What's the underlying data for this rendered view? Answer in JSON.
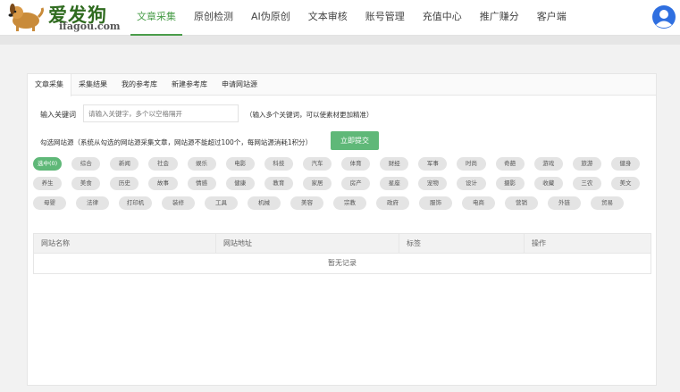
{
  "logo": {
    "cn": "爱发狗",
    "en": "ifagou.com"
  },
  "nav": [
    {
      "label": "文章采集",
      "active": true
    },
    {
      "label": "原创检测",
      "active": false
    },
    {
      "label": "AI伪原创",
      "active": false
    },
    {
      "label": "文本审核",
      "active": false
    },
    {
      "label": "账号管理",
      "active": false
    },
    {
      "label": "充值中心",
      "active": false
    },
    {
      "label": "推广赚分",
      "active": false
    },
    {
      "label": "客户端",
      "active": false
    }
  ],
  "tabs": [
    {
      "label": "文章采集",
      "active": true
    },
    {
      "label": "采集结果",
      "active": false
    },
    {
      "label": "我的参考库",
      "active": false
    },
    {
      "label": "新建参考库",
      "active": false
    },
    {
      "label": "申请网站源",
      "active": false
    }
  ],
  "keyword": {
    "label": "输入关键词",
    "placeholder": "请输入关键字，多个以空格隔开",
    "hint": "（输入多个关键词，可以使素材更加精准）"
  },
  "site_note": "勾选网站源（系统从勾选的网站源采集文章，网站源不能超过100个，每网站源消耗1积分）",
  "submit_label": "立即提交",
  "categories": [
    [
      "选中(0)",
      "综合",
      "新闻",
      "社会",
      "娱乐",
      "电影",
      "科技",
      "汽车",
      "体育",
      "财经",
      "军事",
      "时尚",
      "奇葩",
      "游戏",
      "旅游",
      "健身"
    ],
    [
      "养生",
      "美食",
      "历史",
      "故事",
      "情感",
      "健康",
      "教育",
      "家居",
      "房产",
      "星座",
      "宠物",
      "设计",
      "摄影",
      "收藏",
      "三农",
      "美文"
    ],
    [
      "母婴",
      "法律",
      "打印机",
      "装修",
      "工具",
      "机械",
      "美容",
      "宗教",
      "政府",
      "服饰",
      "电商",
      "营销",
      "外链",
      "贸易"
    ]
  ],
  "selected_category": "选中(0)",
  "table": {
    "headers": [
      "网站名称",
      "网站地址",
      "标签",
      "操作"
    ],
    "empty_text": "暂无记录"
  },
  "colors": {
    "accent": "#5fb878",
    "nav_active": "#4a9d4a",
    "user_icon": "#2f6fe0"
  },
  "icons": {
    "user": "user-avatar-icon",
    "logo": "dog-logo-icon"
  }
}
